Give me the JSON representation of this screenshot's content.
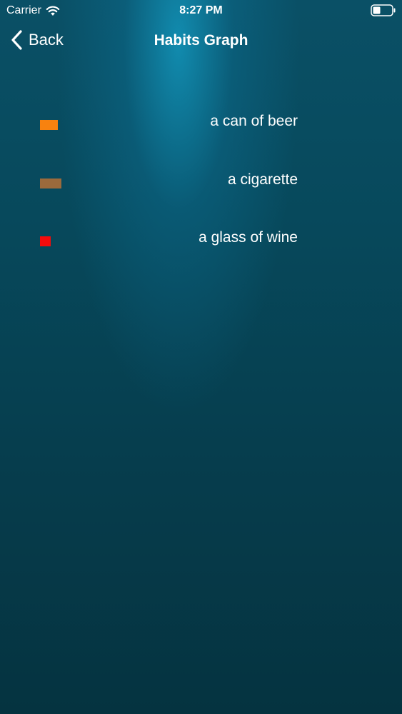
{
  "status_bar": {
    "carrier": "Carrier",
    "time": "8:27 PM",
    "wifi_icon": "wifi-icon",
    "battery_icon": "battery-icon"
  },
  "nav": {
    "back_label": "Back",
    "back_icon": "chevron-left-icon",
    "title": "Habits Graph"
  },
  "legend": {
    "items": [
      {
        "label": "a can of beer",
        "color": "#f8820f"
      },
      {
        "label": "a cigarette",
        "color": "#9b6a3c"
      },
      {
        "label": "a glass of wine",
        "color": "#f40b0b"
      }
    ]
  }
}
